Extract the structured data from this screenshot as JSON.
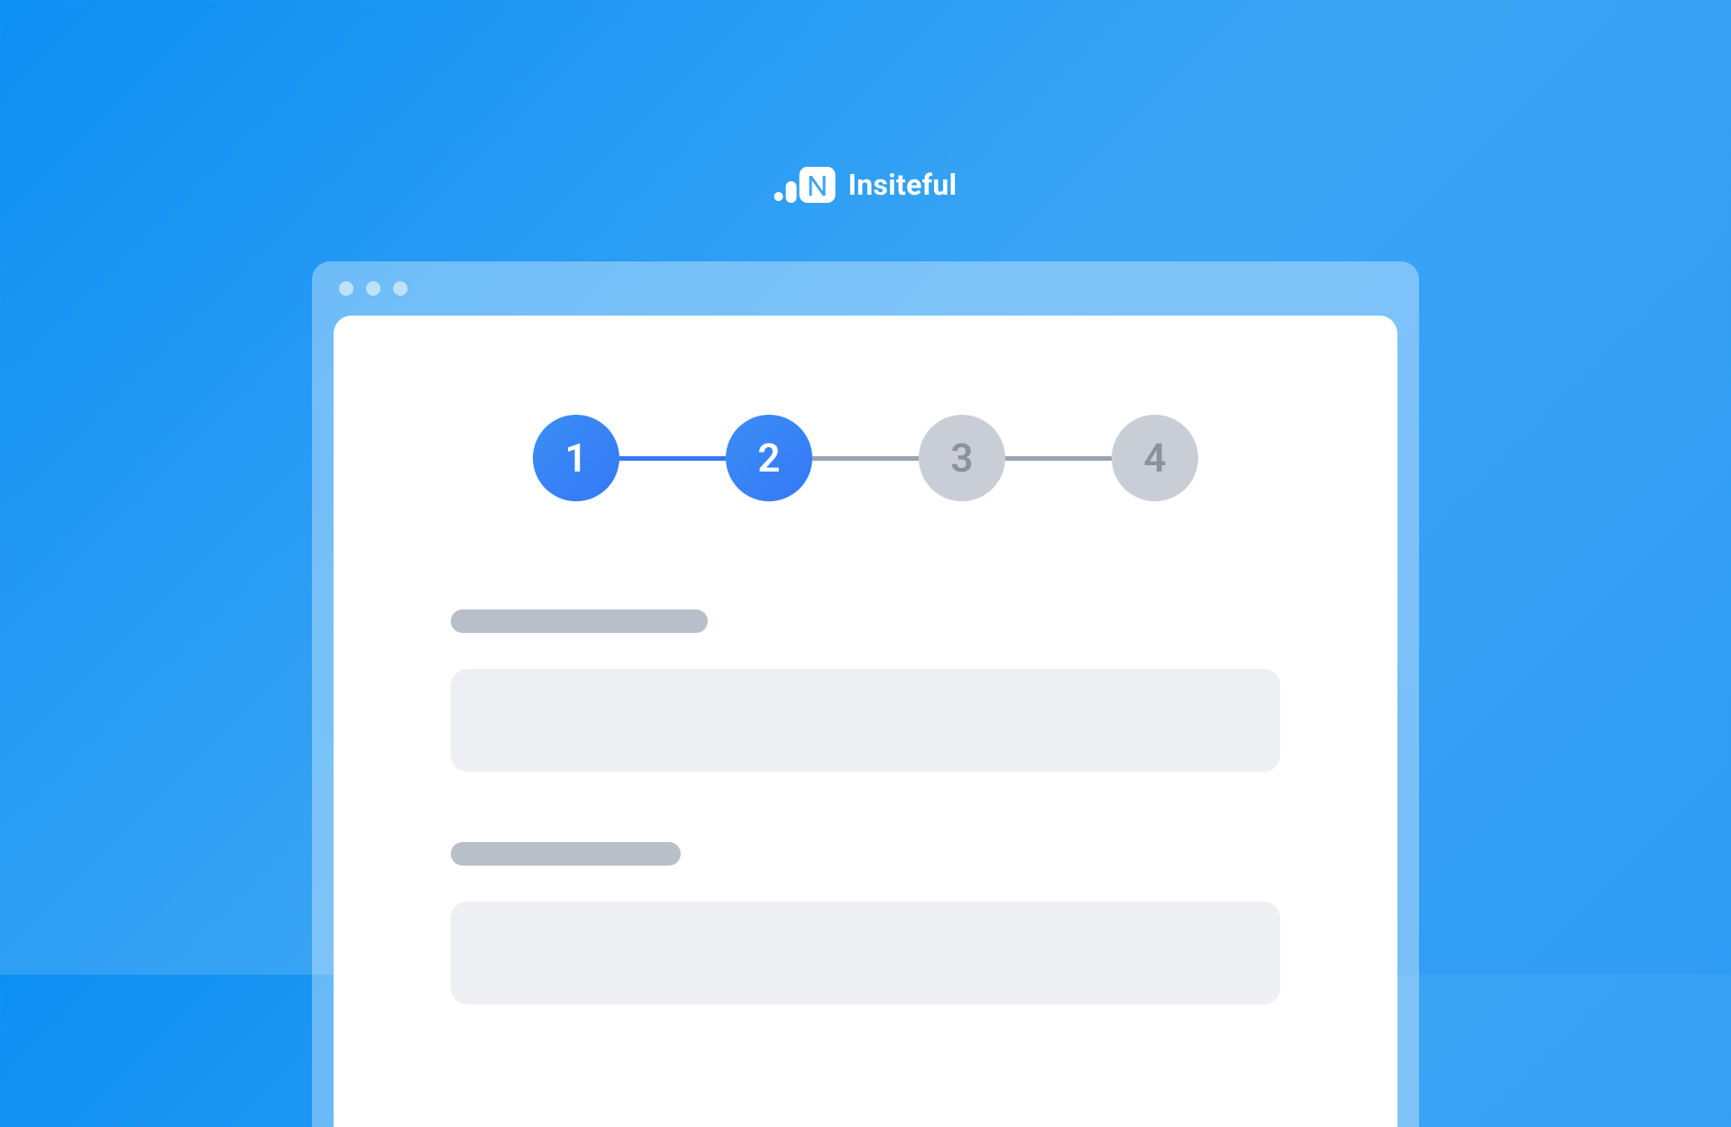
{
  "brand": {
    "name": "Insiteful"
  },
  "stepper": {
    "steps": [
      {
        "number": "1",
        "state": "active"
      },
      {
        "number": "2",
        "state": "active"
      },
      {
        "number": "3",
        "state": "inactive"
      },
      {
        "number": "4",
        "state": "inactive"
      }
    ],
    "connectors": [
      "active",
      "inactive",
      "inactive"
    ]
  },
  "colors": {
    "backgroundGradientStart": "#0d8ff2",
    "backgroundGradientEnd": "#2f9bf4",
    "stepActive": "#3478f6",
    "stepInactive": "#c9ced6",
    "stepInactiveText": "#8a92a0",
    "placeholderLabel": "#b8bfc9",
    "placeholderInput": "#eeeff3"
  }
}
